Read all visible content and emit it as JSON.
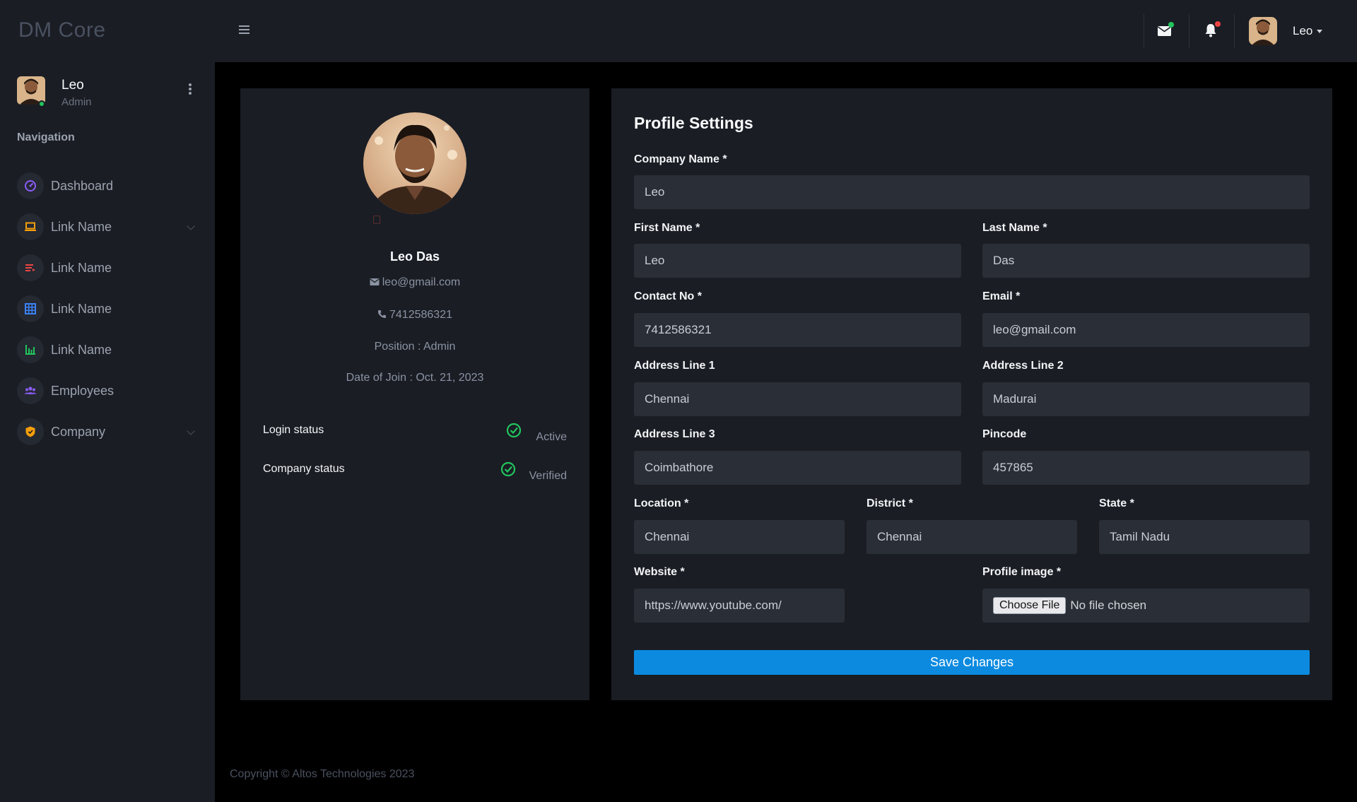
{
  "app": {
    "brand": "DM Core"
  },
  "header": {
    "user_name": "Leo",
    "mail_dot_color": "#22c55e",
    "bell_dot_color": "#ef4444"
  },
  "sidebar": {
    "user": {
      "name": "Leo",
      "role": "Admin"
    },
    "heading": "Navigation",
    "items": [
      {
        "label": "Dashboard",
        "icon": "gauge-icon",
        "color": "#8b5cf6",
        "has_chevron": false
      },
      {
        "label": "Link Name",
        "icon": "laptop-icon",
        "color": "#f59e0b",
        "has_chevron": true
      },
      {
        "label": "Link Name",
        "icon": "list-icon",
        "color": "#ef4444",
        "has_chevron": false
      },
      {
        "label": "Link Name",
        "icon": "grid-icon",
        "color": "#3b82f6",
        "has_chevron": false
      },
      {
        "label": "Link Name",
        "icon": "bar-chart-icon",
        "color": "#22c55e",
        "has_chevron": false
      },
      {
        "label": "Employees",
        "icon": "users-icon",
        "color": "#8b5cf6",
        "has_chevron": false
      },
      {
        "label": "Company",
        "icon": "shield-icon",
        "color": "#f59e0b",
        "has_chevron": true
      }
    ]
  },
  "profile_card": {
    "name": "Leo Das",
    "email": "leo@gmail.com",
    "phone": "7412586321",
    "position": "Position : Admin",
    "date_of_join": "Date of Join : Oct. 21, 2023",
    "login_status_label": "Login status",
    "login_status_value": "Active",
    "company_status_label": "Company status",
    "company_status_value": "Verified"
  },
  "form": {
    "title": "Profile Settings",
    "company_name": {
      "label": "Company Name *",
      "value": "Leo"
    },
    "first_name": {
      "label": "First Name *",
      "value": "Leo"
    },
    "last_name": {
      "label": "Last Name *",
      "value": "Das"
    },
    "contact_no": {
      "label": "Contact No *",
      "value": "7412586321"
    },
    "email": {
      "label": "Email *",
      "value": "leo@gmail.com"
    },
    "address_1": {
      "label": "Address Line 1",
      "value": "Chennai"
    },
    "address_2": {
      "label": "Address Line 2",
      "value": "Madurai"
    },
    "address_3": {
      "label": "Address Line 3",
      "value": "Coimbathore"
    },
    "pincode": {
      "label": "Pincode",
      "value": "457865"
    },
    "location": {
      "label": "Location *",
      "value": "Chennai"
    },
    "district": {
      "label": "District *",
      "value": "Chennai"
    },
    "state": {
      "label": "State *",
      "value": "Tamil Nadu"
    },
    "website": {
      "label": "Website *",
      "value": "https://www.youtube.com/"
    },
    "profile_image": {
      "label": "Profile image *",
      "button": "Choose File",
      "status": "No file chosen"
    },
    "save_label": "Save Changes"
  },
  "footer": {
    "copyright": "Copyright © Altos Technologies 2023"
  }
}
